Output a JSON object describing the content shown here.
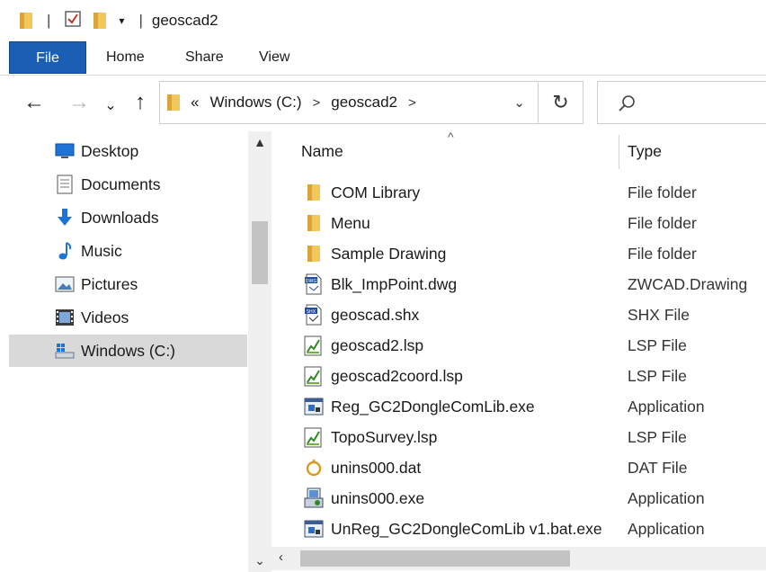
{
  "window": {
    "title": "geoscad2"
  },
  "ribbon": {
    "tabs": [
      {
        "label": "File"
      },
      {
        "label": "Home"
      },
      {
        "label": "Share"
      },
      {
        "label": "View"
      }
    ]
  },
  "address": {
    "prefix": "«",
    "crumbs": [
      "Windows (C:)",
      "geoscad2"
    ],
    "separator": ">"
  },
  "nav_items": [
    {
      "label": "Desktop",
      "icon": "desktop-icon"
    },
    {
      "label": "Documents",
      "icon": "documents-icon"
    },
    {
      "label": "Downloads",
      "icon": "downloads-icon"
    },
    {
      "label": "Music",
      "icon": "music-icon"
    },
    {
      "label": "Pictures",
      "icon": "pictures-icon"
    },
    {
      "label": "Videos",
      "icon": "videos-icon"
    },
    {
      "label": "Windows (C:)",
      "icon": "drive-icon",
      "selected": true
    }
  ],
  "columns": {
    "name": "Name",
    "type": "Type"
  },
  "files": [
    {
      "name": "COM Library",
      "type": "File folder",
      "icon": "folder-icon"
    },
    {
      "name": "Menu",
      "type": "File folder",
      "icon": "folder-icon"
    },
    {
      "name": "Sample Drawing",
      "type": "File folder",
      "icon": "folder-icon"
    },
    {
      "name": "Blk_ImpPoint.dwg",
      "type": "ZWCAD.Drawing",
      "icon": "dwg-file-icon"
    },
    {
      "name": "geoscad.shx",
      "type": "SHX File",
      "icon": "shx-file-icon"
    },
    {
      "name": "geoscad2.lsp",
      "type": "LSP File",
      "icon": "lsp-file-icon"
    },
    {
      "name": "geoscad2coord.lsp",
      "type": "LSP File",
      "icon": "lsp-file-icon"
    },
    {
      "name": "Reg_GC2DongleComLib.exe",
      "type": "Application",
      "icon": "exe-file-icon"
    },
    {
      "name": "TopoSurvey.lsp",
      "type": "LSP File",
      "icon": "lsp-file-icon"
    },
    {
      "name": "unins000.dat",
      "type": "DAT File",
      "icon": "dat-file-icon"
    },
    {
      "name": "unins000.exe",
      "type": "Application",
      "icon": "installer-icon"
    },
    {
      "name": "UnReg_GC2DongleComLib v1.bat.exe",
      "type": "Application",
      "icon": "exe-file-icon"
    }
  ],
  "colors": {
    "accent": "#1a5fb4",
    "selected": "#d9d9d9",
    "folder": "#f2c75c"
  }
}
